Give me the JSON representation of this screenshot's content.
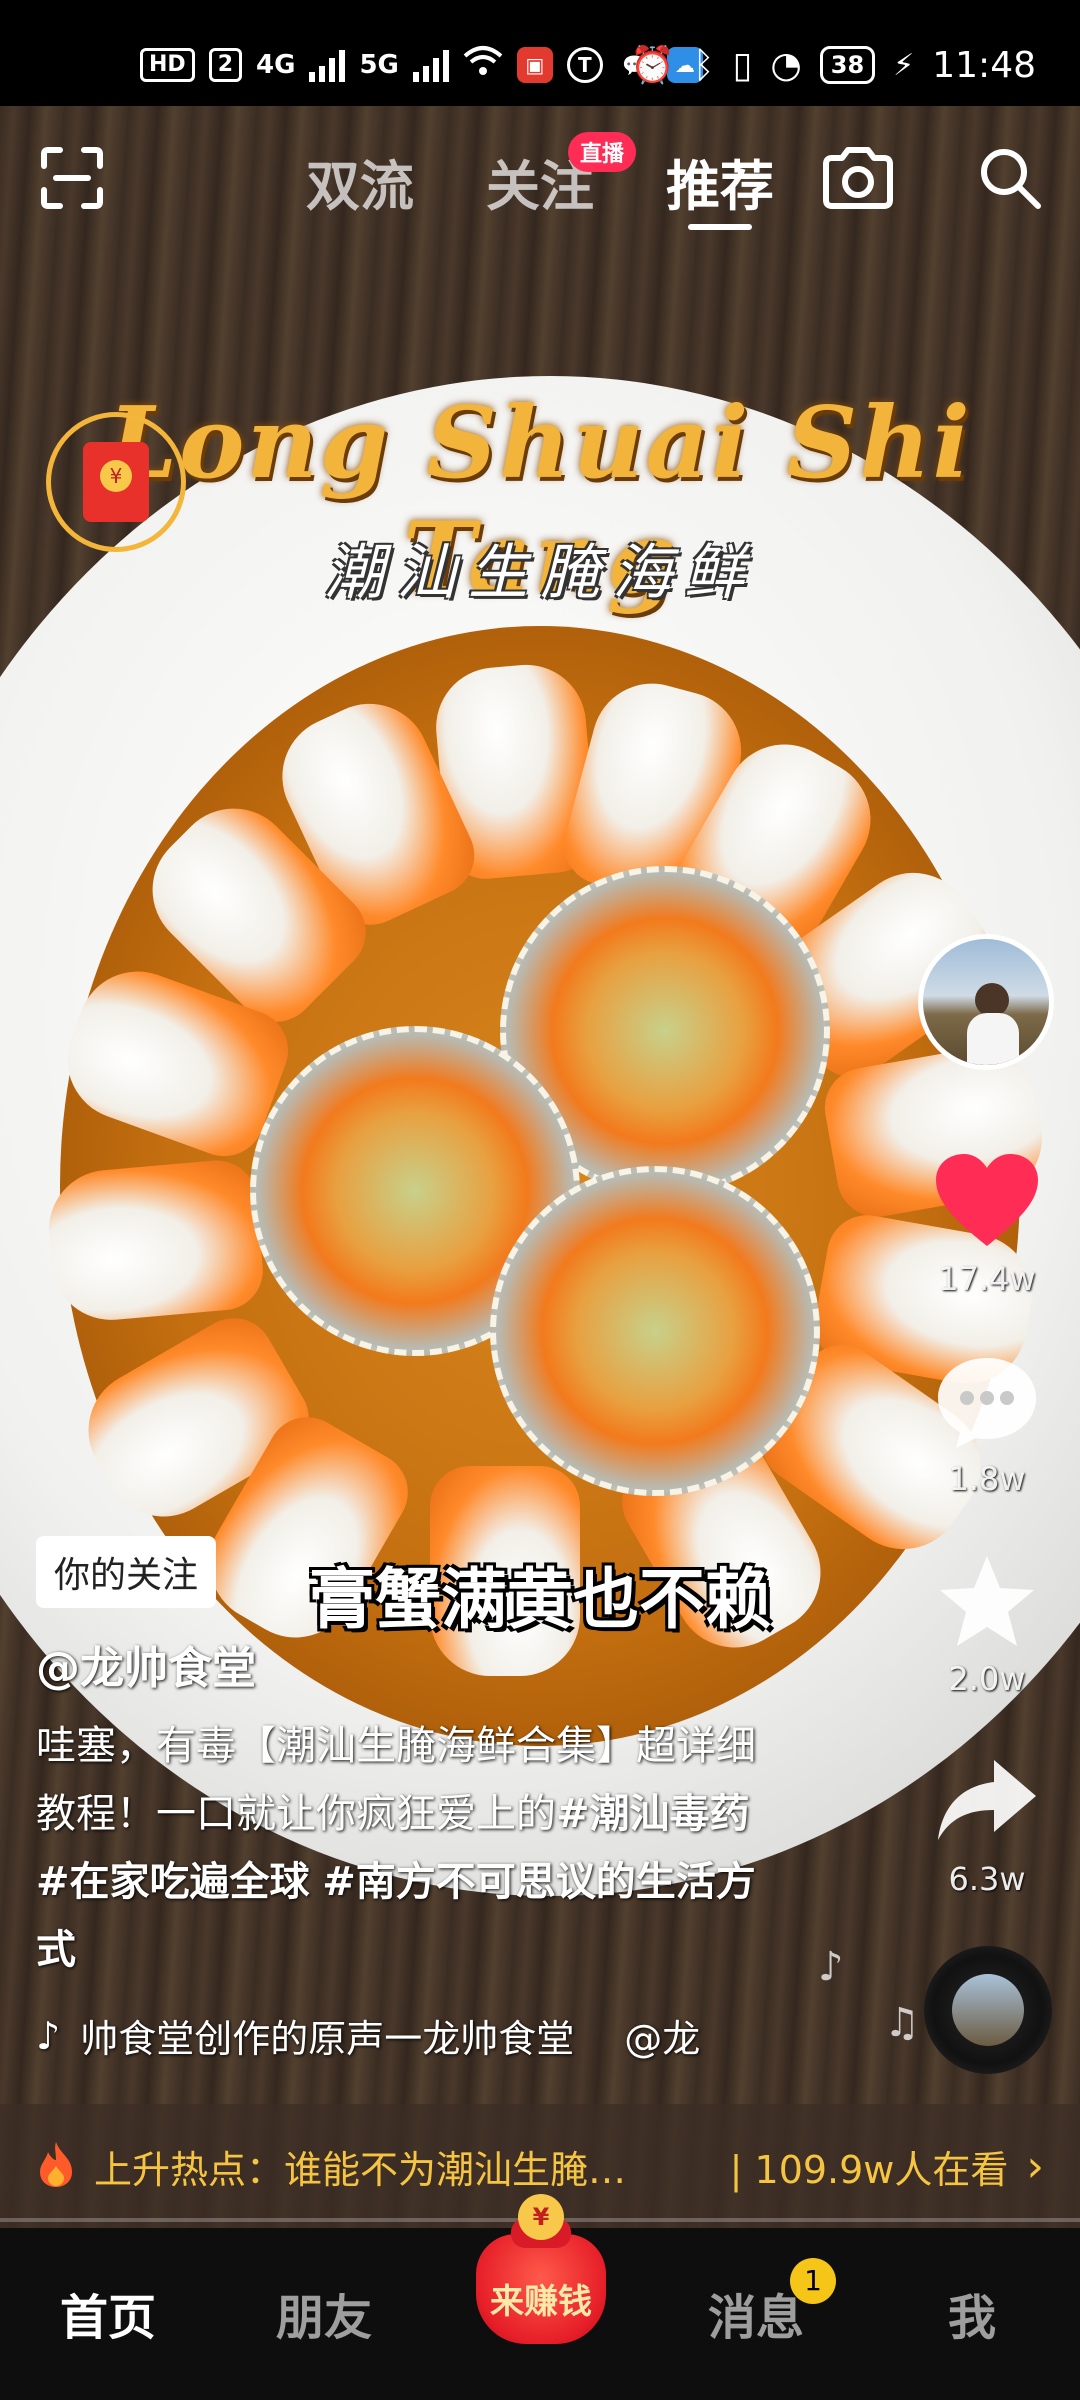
{
  "status_bar": {
    "left_chips": [
      "HD",
      "2"
    ],
    "net1": "4G",
    "net2": "5G",
    "battery": "38",
    "time": "11:48"
  },
  "top_nav": {
    "tabs": [
      "双流",
      "关注",
      "推荐"
    ],
    "active_tab": "推荐",
    "live_badge": "直播"
  },
  "video": {
    "title_art": "Long Shuai Shi Tang",
    "subtitle_art": "潮汕生腌海鲜",
    "caption": "膏蟹满黄也不赖"
  },
  "rail": {
    "likes": "17.4w",
    "comments": "1.8w",
    "favorites": "2.0w",
    "shares": "6.3w"
  },
  "post": {
    "follow_tag": "你的关注",
    "author": "@龙帅食堂",
    "desc_plain": "哇塞，有毒【潮汕生腌海鲜合集】超详细教程！一口就让你疯狂爱上的",
    "tags": [
      "#潮汕毒药",
      "#在家吃遍全球",
      "#南方不可思议的生活方式"
    ],
    "music": "帅食堂创作的原声一龙帅食堂",
    "music_mention": "@龙"
  },
  "hot_bar": {
    "label": "上升热点：谁能不为潮汕生腌…",
    "count": "| 109.9w人在看"
  },
  "bottom_nav": {
    "tabs": [
      "首页",
      "朋友",
      "消息",
      "我"
    ],
    "earn_label": "来赚钱",
    "earn_coin": "¥",
    "message_badge": "1"
  },
  "red_envelope": {
    "symbol": "¥"
  },
  "colors": {
    "accent_red": "#ff2c55",
    "like_red": "#ff2c55",
    "hot_yellow": "#f5c542"
  }
}
